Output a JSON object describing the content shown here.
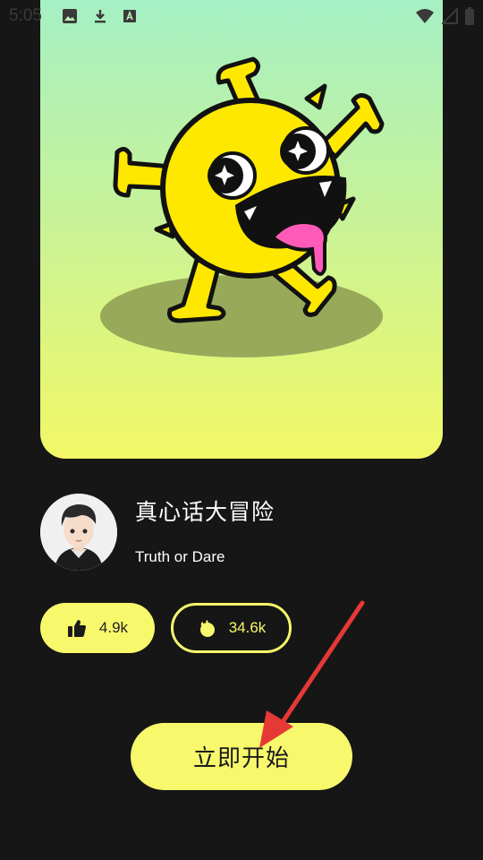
{
  "status_bar": {
    "time": "5:05",
    "icons": [
      "image-icon",
      "download-icon",
      "font-icon",
      "wifi-icon",
      "signal-icon",
      "battery-icon"
    ]
  },
  "app": {
    "title": "真心话大冒险",
    "subtitle": "Truth or Dare"
  },
  "stats": {
    "likes": "4.9k",
    "views": "34.6k"
  },
  "start_button": {
    "label": "立即开始"
  },
  "colors": {
    "accent": "#f7f86b",
    "background": "#161616",
    "mascot_yellow": "#ffe800",
    "annotation_red": "#e53935"
  }
}
